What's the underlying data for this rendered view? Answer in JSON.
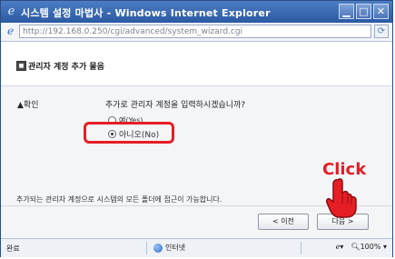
{
  "window": {
    "title": "시스템 설정 마법사 - Windows Internet Explorer",
    "icon": "ie-icon",
    "controls": [
      "minimize",
      "maximize",
      "close"
    ]
  },
  "address": {
    "url": "http://192.168.0.250/cgi/advanced/system_wizard.cgi"
  },
  "page": {
    "header_title": "관리자 계정 추가 물음",
    "confirm_label": "확인",
    "question": "추가로 관리자 계정을 입력하시겠습니까?",
    "options": [
      {
        "label": "예(Yes)",
        "selected": false
      },
      {
        "label": "아니오(No)",
        "selected": true
      }
    ],
    "note": "추가되는 관리자 계정으로 시스템의 모든 폴더에 접근이 가능합니다.",
    "prev_button": "< 이전",
    "next_button": "다음 >",
    "annotation": "Click"
  },
  "status": {
    "left": "완료",
    "zone": "인터넷",
    "zoom": "100%",
    "zoom_icon": "magnifier-icon"
  },
  "colors": {
    "highlight": "#e51e25",
    "titlebar": "#2b5aa3"
  }
}
